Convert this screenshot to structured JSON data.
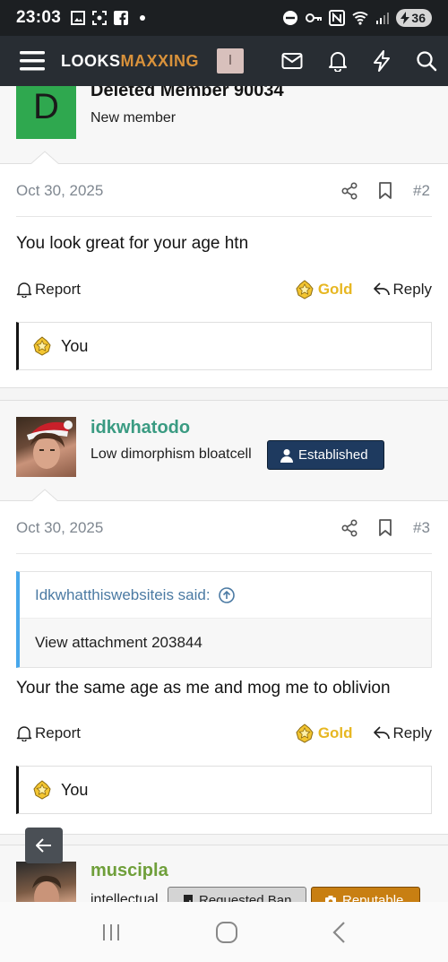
{
  "status_bar": {
    "time": "23:03",
    "battery": "36"
  },
  "navbar": {
    "logo_part1": "LOOKS",
    "logo_part2": "MAXXING",
    "user_initial": "I"
  },
  "posts": [
    {
      "username": "Deleted Member 90034",
      "user_title": "New member",
      "avatar_letter": "D",
      "avatar_color": "#2fa84f",
      "date": "Oct 30, 2025",
      "number": "#2",
      "message": "You look great for your age htn",
      "report_label": "Report",
      "gold_label": "Gold",
      "reply_label": "Reply",
      "reaction_label": "You"
    },
    {
      "username": "idkwhatodo",
      "user_title": "Low dimorphism bloatcell",
      "badge": "Established",
      "date": "Oct 30, 2025",
      "number": "#3",
      "quote_author": "Idkwhatthiswebsiteis said:",
      "quote_text": "View attachment 203844",
      "message": "Your the same age as me and mog me to oblivion",
      "report_label": "Report",
      "gold_label": "Gold",
      "reply_label": "Reply",
      "reaction_label": "You"
    },
    {
      "username": "muscipla",
      "user_title": "intellectual",
      "badge1": "Requested Ban",
      "badge2": "Reputable"
    }
  ],
  "colors": {
    "accent": "#d9923b",
    "gold": "#e7b722",
    "username_green": "#3a9b82",
    "username_green2": "#6f9f3a"
  }
}
